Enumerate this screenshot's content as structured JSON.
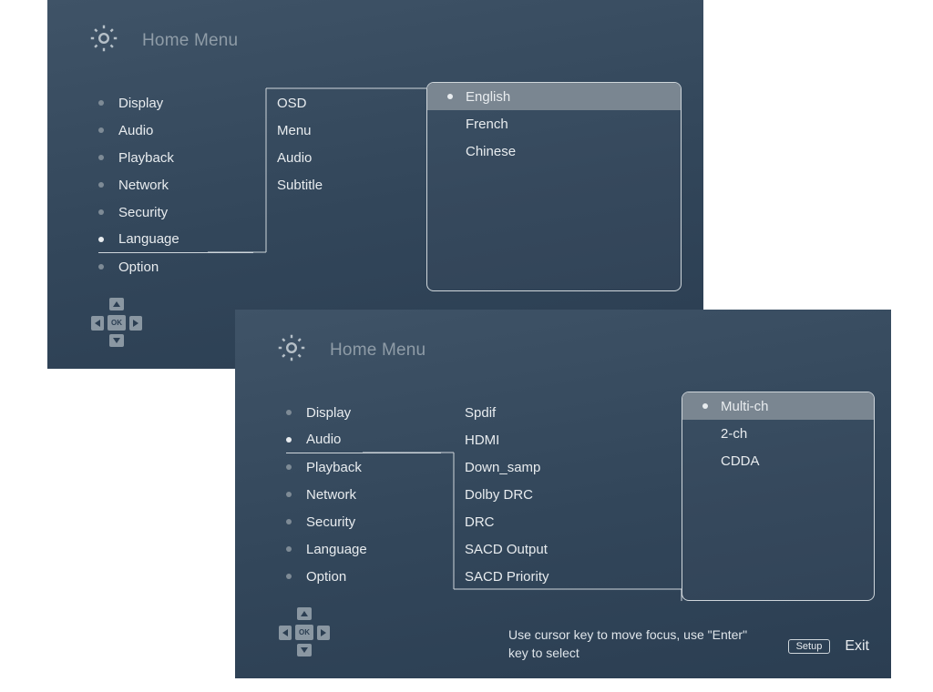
{
  "header": {
    "title": "Home Menu"
  },
  "categories": [
    "Display",
    "Audio",
    "Playback",
    "Network",
    "Security",
    "Language",
    "Option"
  ],
  "panel1": {
    "selected_category_index": 5,
    "submenu": [
      "OSD",
      "Menu",
      "Audio",
      "Subtitle"
    ],
    "options": [
      "English",
      "French",
      "Chinese"
    ],
    "selected_option_index": 0
  },
  "panel2": {
    "selected_category_index": 1,
    "submenu": [
      "Spdif",
      "HDMI",
      "Down_samp",
      "Dolby DRC",
      "DRC",
      "SACD Output",
      "SACD Priority"
    ],
    "options": [
      "Multi-ch",
      "2-ch",
      "CDDA"
    ],
    "selected_option_index": 0
  },
  "footer": {
    "ok_label": "OK",
    "hint": "Use cursor key to move focus, use \"Enter\" key to select",
    "setup_label": "Setup",
    "exit_label": "Exit"
  }
}
